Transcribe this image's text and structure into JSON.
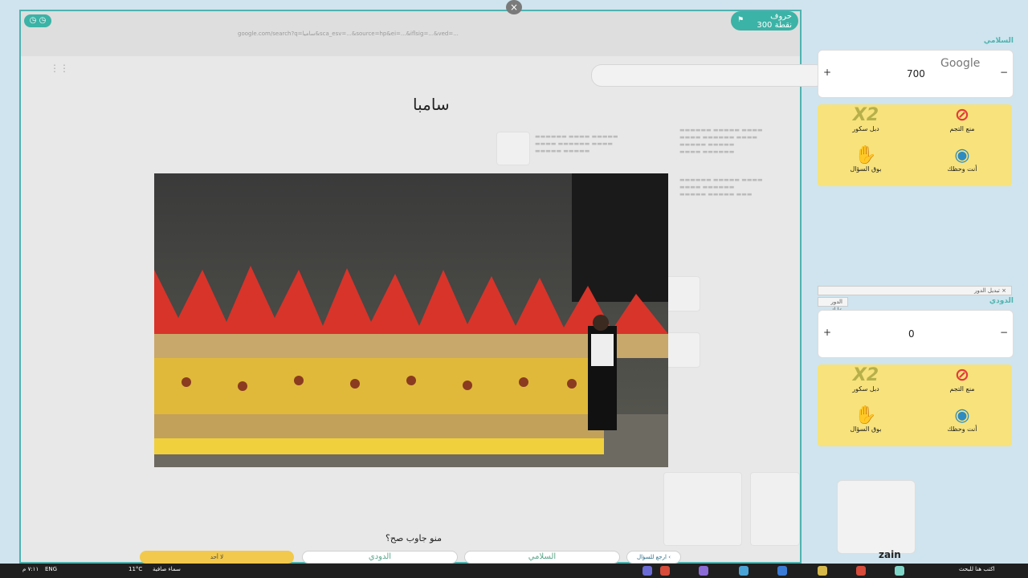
{
  "browser": {
    "url": "google.com/search?q=ساميا&sca_esv=...&source=hp&ei=...&iflsig=...&ved=..."
  },
  "game": {
    "timer_icon": "clock-icon",
    "close_symbol": "×",
    "score": {
      "line1": "حروف",
      "line2": "300 نقطة",
      "flag_icon": "flag-icon"
    },
    "title": "سامبا",
    "question": "منو جاوب صح؟",
    "answers": {
      "none": "لا أحد",
      "doodi": "الدودي",
      "salami": "السلامي",
      "back": "ارجع للسؤال"
    }
  },
  "sidebar": {
    "team1": {
      "name": "السلامي",
      "score": "700",
      "google_word": "Google",
      "minus": "−",
      "plus": "+"
    },
    "team2": {
      "name": "الدودي",
      "score": "0",
      "minus": "−",
      "plus": "+"
    },
    "turn_change": "تبديل الدور",
    "your_turn": "الدور عليك",
    "close_symbol": "×",
    "lifelines": {
      "ban": "منع التجم",
      "x2": "دبل سكور",
      "wheel": "أنت وحظك",
      "hand": "بوق السؤال"
    }
  },
  "taskbar": {
    "weather": "سماء صافية",
    "temp": "11°C",
    "lang": "ENG",
    "time": "٧:١١ م",
    "date": "٢٠٢٤/١/٢٧",
    "search_placeholder": "اكتب هنا للبحث"
  },
  "brand": "zain"
}
